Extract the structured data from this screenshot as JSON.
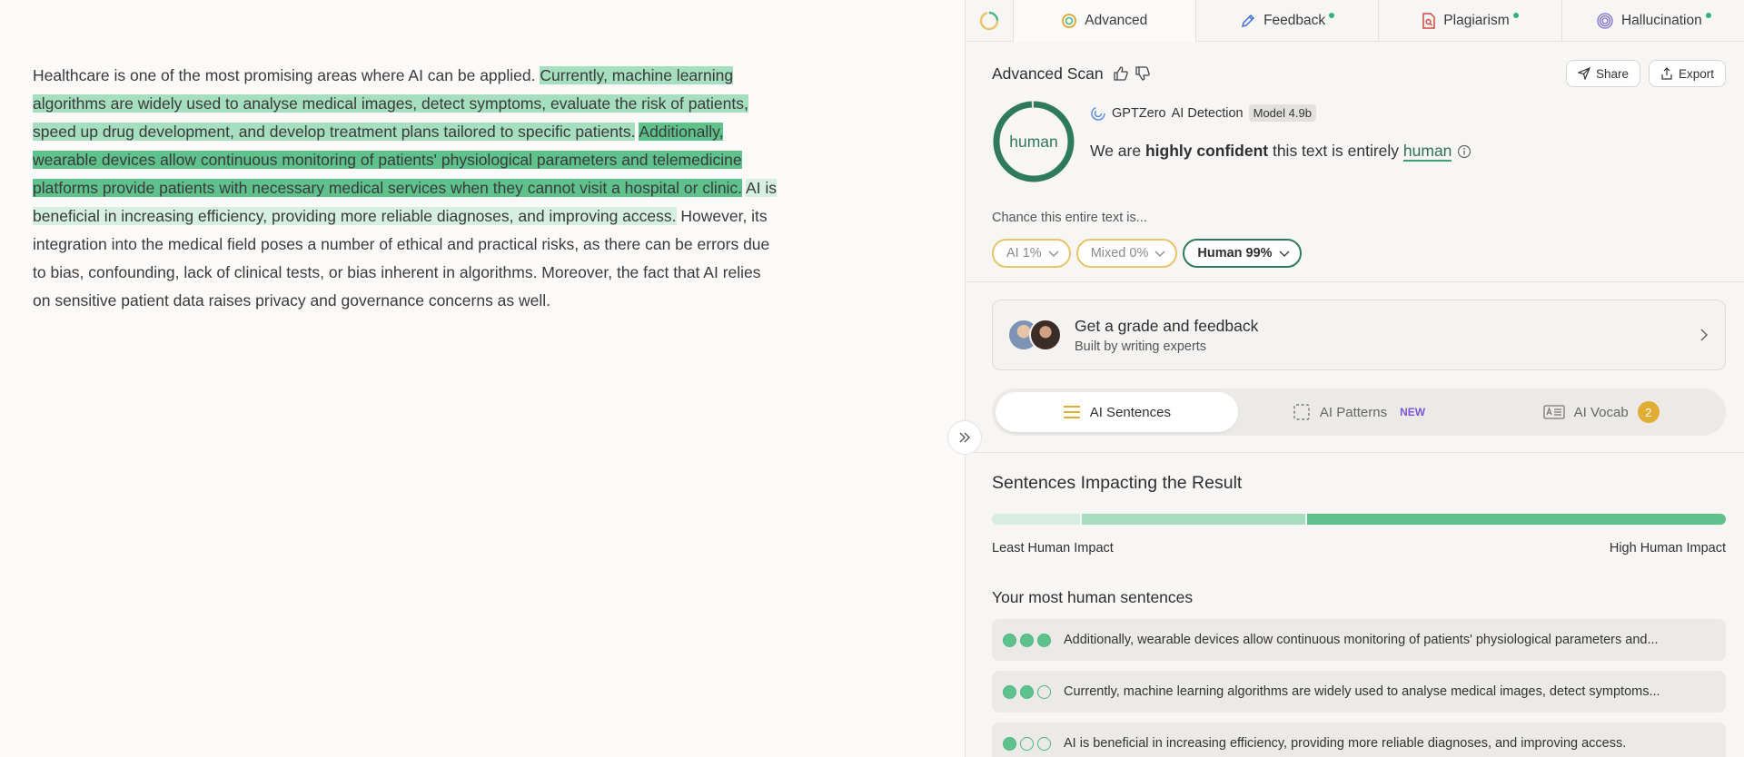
{
  "document": {
    "segments": [
      {
        "text": "Healthcare is one of the most promising areas where AI can be applied. ",
        "level": "none"
      },
      {
        "text": "Currently, machine learning algorithms are widely used to analyse medical images, detect symptoms, evaluate the risk of patients, speed up drug development, and develop treatment plans tailored to specific patients.",
        "level": "mid"
      },
      {
        "text": " ",
        "level": "none"
      },
      {
        "text": "Additionally, wearable devices allow continuous monitoring of patients' physiological parameters and telemedicine platforms provide patients with necessary medical services when they cannot visit a hospital or clinic.",
        "level": "strong"
      },
      {
        "text": " ",
        "level": "none"
      },
      {
        "text": "AI is beneficial in increasing efficiency, providing more reliable diagnoses, and improving access.",
        "level": "light"
      },
      {
        "text": " However, its integration into the medical field poses a number of ethical and practical risks, as there can be errors due to bias, confounding, lack of clinical tests, or bias inherent in algorithms. Moreover, the fact that AI relies on sensitive patient data raises privacy and governance concerns as well.",
        "level": "none"
      }
    ]
  },
  "tabs": [
    {
      "label": "Advanced",
      "icon": "advanced-icon",
      "active": true,
      "dot": false
    },
    {
      "label": "Feedback",
      "icon": "pen-icon",
      "active": false,
      "dot": true
    },
    {
      "label": "Plagiarism",
      "icon": "document-search-icon",
      "active": false,
      "dot": true
    },
    {
      "label": "Hallucination",
      "icon": "spiral-icon",
      "active": false,
      "dot": true
    }
  ],
  "scan": {
    "title": "Advanced Scan",
    "share_label": "Share",
    "export_label": "Export",
    "gauge_label": "human",
    "gauge_value": 0.99,
    "detector_name": "GPTZero",
    "detector_suffix": "AI Detection",
    "model": "Model 4.9b",
    "confidence_prefix": "We are ",
    "confidence_bold": "highly confident",
    "confidence_middle": " this text is entirely ",
    "confidence_word": "human"
  },
  "chance": {
    "label": "Chance this entire text is...",
    "ai": "AI 1%",
    "mixed": "Mixed 0%",
    "human": "Human 99%"
  },
  "grade": {
    "title": "Get a grade and feedback",
    "subtitle": "Built by writing experts"
  },
  "segmented": {
    "sentences": "AI Sentences",
    "patterns": "AI Patterns",
    "patterns_tag": "NEW",
    "vocab": "AI Vocab",
    "vocab_count": "2"
  },
  "impact": {
    "title": "Sentences Impacting the Result",
    "left": "Least Human Impact",
    "right": "High Human Impact"
  },
  "most_human": {
    "title": "Your most human sentences",
    "rows": [
      {
        "text": "Additionally, wearable devices allow continuous monitoring of patients' physiological parameters and...",
        "score": 3
      },
      {
        "text": "Currently, machine learning algorithms are widely used to analyse medical images, detect symptoms...",
        "score": 2
      },
      {
        "text": "AI is beneficial in increasing efficiency, providing more reliable diagnoses, and improving access.",
        "score": 1
      }
    ]
  },
  "colors": {
    "accent_green": "#5fc28d",
    "dark_green": "#2f7a5a",
    "yellow": "#e8c468"
  }
}
